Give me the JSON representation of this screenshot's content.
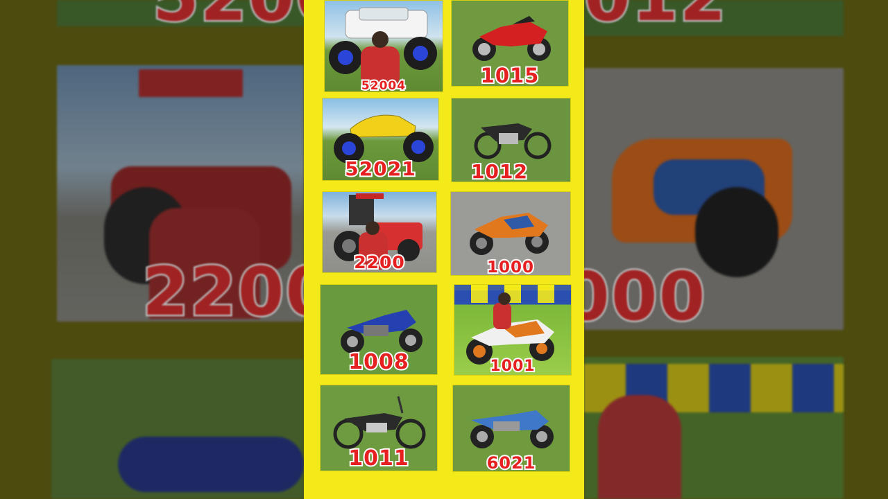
{
  "panel_background": "#f4ea1a",
  "label_color": "#e62020",
  "vehicles": [
    {
      "code": "52004",
      "type": "monster-suv-icon"
    },
    {
      "code": "1015",
      "type": "sport-bike-icon"
    },
    {
      "code": "52021",
      "type": "monster-car-icon"
    },
    {
      "code": "1012",
      "type": "classic-bike-icon"
    },
    {
      "code": "2200",
      "type": "tractor-icon"
    },
    {
      "code": "1000",
      "type": "sport-bike-icon"
    },
    {
      "code": "1008",
      "type": "commuter-bike-icon"
    },
    {
      "code": "1001",
      "type": "sport-bike-rider-icon"
    },
    {
      "code": "1011",
      "type": "classic-bike-icon"
    },
    {
      "code": "6021",
      "type": "commuter-bike-icon"
    }
  ],
  "backdrop": {
    "left_numbers": [
      "5200",
      "2200"
    ],
    "right_numbers": [
      "012",
      "000"
    ]
  }
}
